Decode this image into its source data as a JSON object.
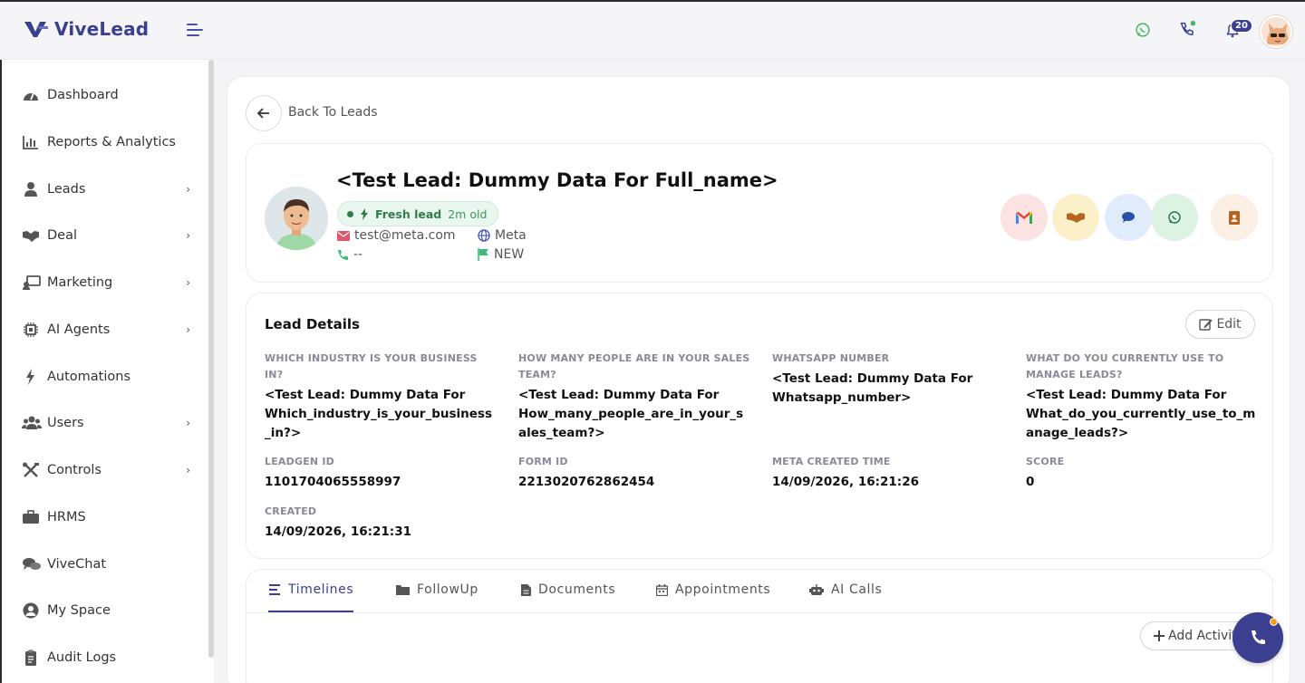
{
  "header": {
    "brand": "ViveLead",
    "notification_count": "20",
    "brand_color": "#3a3f8f"
  },
  "sidebar": {
    "items": [
      {
        "label": "Dashboard",
        "icon": "dashboard-icon"
      },
      {
        "label": "Reports & Analytics",
        "icon": "chart-icon"
      },
      {
        "label": "Leads",
        "icon": "user-icon"
      },
      {
        "label": "Deal",
        "icon": "handshake-icon"
      },
      {
        "label": "Marketing",
        "icon": "marketing-icon"
      },
      {
        "label": "AI Agents",
        "icon": "chip-icon"
      },
      {
        "label": "Automations",
        "icon": "bolt-icon"
      },
      {
        "label": "Users",
        "icon": "users-icon"
      },
      {
        "label": "Controls",
        "icon": "tools-icon"
      },
      {
        "label": "HRMS",
        "icon": "briefcase-icon"
      },
      {
        "label": "ViveChat",
        "icon": "chat-icon"
      },
      {
        "label": "My Space",
        "icon": "user-circle-icon"
      },
      {
        "label": "Audit Logs",
        "icon": "clipboard-icon"
      }
    ]
  },
  "main": {
    "back_label": "Back To Leads",
    "lead": {
      "name": "<Test Lead: Dummy Data For Full_name>",
      "status_label": "Fresh lead",
      "age": "2m old",
      "email": "test@meta.com",
      "phone": "--",
      "source": "Meta",
      "stage": "NEW"
    },
    "details": {
      "title": "Lead Details",
      "edit_label": "Edit",
      "fields": [
        {
          "label": "WHICH INDUSTRY IS YOUR BUSINESS IN?",
          "value": "<Test Lead: Dummy Data For Which_industry_is_your_business_in?>"
        },
        {
          "label": "HOW MANY PEOPLE ARE IN YOUR SALES TEAM?",
          "value": "<Test Lead: Dummy Data For How_many_people_are_in_your_sales_team?>"
        },
        {
          "label": "WHATSAPP NUMBER",
          "value": "<Test Lead: Dummy Data For Whatsapp_number>"
        },
        {
          "label": "WHAT DO YOU CURRENTLY USE TO MANAGE LEADS?",
          "value": "<Test Lead: Dummy Data For What_do_you_currently_use_to_manage_leads?>"
        },
        {
          "label": "LEADGEN ID",
          "value": "1101704065558997"
        },
        {
          "label": "FORM ID",
          "value": "2213020762862454"
        },
        {
          "label": "META CREATED TIME",
          "value": "14/09/2026, 16:21:26"
        },
        {
          "label": "SCORE",
          "value": "0"
        },
        {
          "label": "CREATED",
          "value": "14/09/2026, 16:21:31"
        }
      ]
    },
    "tabs": [
      {
        "label": "Timelines",
        "icon": "list-icon"
      },
      {
        "label": "FollowUp",
        "icon": "folder-icon"
      },
      {
        "label": "Documents",
        "icon": "document-icon"
      },
      {
        "label": "Appointments",
        "icon": "calendar-icon"
      },
      {
        "label": "AI Calls",
        "icon": "robot-icon"
      }
    ],
    "add_activity_label": "Add Activity"
  }
}
